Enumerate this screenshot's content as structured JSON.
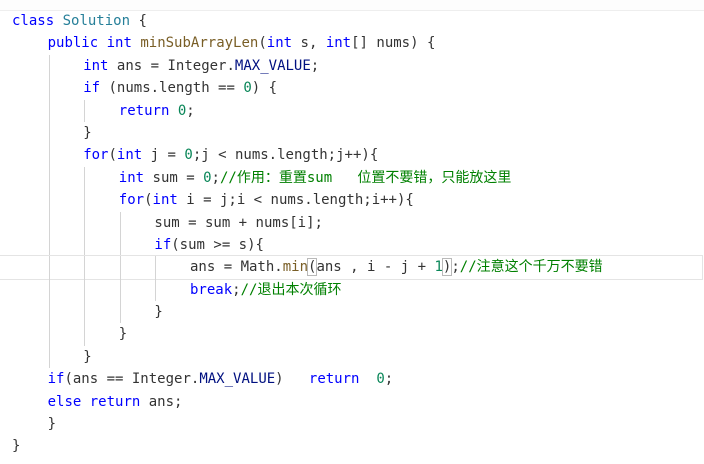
{
  "editor": {
    "lines": [
      {
        "indent": 0,
        "tokens": [
          [
            "kw",
            "class"
          ],
          [
            "plain",
            " "
          ],
          [
            "cls",
            "Solution"
          ],
          [
            "plain",
            " {"
          ]
        ]
      },
      {
        "indent": 1,
        "tokens": [
          [
            "kw",
            "public"
          ],
          [
            "plain",
            " "
          ],
          [
            "type",
            "int"
          ],
          [
            "plain",
            " "
          ],
          [
            "fn",
            "minSubArrayLen"
          ],
          [
            "plain",
            "("
          ],
          [
            "type",
            "int"
          ],
          [
            "plain",
            " s, "
          ],
          [
            "type",
            "int"
          ],
          [
            "plain",
            "[] nums) {"
          ]
        ]
      },
      {
        "indent": 2,
        "tokens": [
          [
            "type",
            "int"
          ],
          [
            "plain",
            " ans = Integer."
          ],
          [
            "field",
            "MAX_VALUE"
          ],
          [
            "plain",
            ";"
          ]
        ]
      },
      {
        "indent": 2,
        "tokens": [
          [
            "kw",
            "if"
          ],
          [
            "plain",
            " (nums.length == "
          ],
          [
            "num",
            "0"
          ],
          [
            "plain",
            ") {"
          ]
        ]
      },
      {
        "indent": 3,
        "tokens": [
          [
            "kw",
            "return"
          ],
          [
            "plain",
            " "
          ],
          [
            "num",
            "0"
          ],
          [
            "plain",
            ";"
          ]
        ]
      },
      {
        "indent": 2,
        "tokens": [
          [
            "plain",
            "}"
          ]
        ]
      },
      {
        "indent": 2,
        "tokens": [
          [
            "kw",
            "for"
          ],
          [
            "plain",
            "("
          ],
          [
            "type",
            "int"
          ],
          [
            "plain",
            " j = "
          ],
          [
            "num",
            "0"
          ],
          [
            "plain",
            ";j < nums.length;j++){"
          ]
        ]
      },
      {
        "indent": 3,
        "tokens": [
          [
            "type",
            "int"
          ],
          [
            "plain",
            " sum = "
          ],
          [
            "num",
            "0"
          ],
          [
            "plain",
            ";"
          ],
          [
            "comment",
            "//作用：重置sum   位置不要错，只能放这里"
          ]
        ]
      },
      {
        "indent": 3,
        "tokens": [
          [
            "kw",
            "for"
          ],
          [
            "plain",
            "("
          ],
          [
            "type",
            "int"
          ],
          [
            "plain",
            " i = j;i < nums.length;i++){"
          ]
        ]
      },
      {
        "indent": 4,
        "tokens": [
          [
            "plain",
            "sum = sum + nums[i];"
          ]
        ]
      },
      {
        "indent": 4,
        "tokens": [
          [
            "kw",
            "if"
          ],
          [
            "plain",
            "(sum >= s){"
          ]
        ]
      },
      {
        "indent": 5,
        "cursor": true,
        "tokens": [
          [
            "plain",
            "ans = Math."
          ],
          [
            "fn",
            "min"
          ],
          [
            "match",
            "("
          ],
          [
            "plain",
            "ans , i - j + "
          ],
          [
            "num",
            "1"
          ],
          [
            "match",
            ")"
          ],
          [
            "plain",
            ";"
          ],
          [
            "comment",
            "//注意这个千万不要错"
          ]
        ]
      },
      {
        "indent": 5,
        "tokens": [
          [
            "kw",
            "break"
          ],
          [
            "plain",
            ";"
          ],
          [
            "comment",
            "//退出本次循环"
          ]
        ]
      },
      {
        "indent": 4,
        "tokens": [
          [
            "plain",
            "}"
          ]
        ]
      },
      {
        "indent": 3,
        "tokens": [
          [
            "plain",
            "}"
          ]
        ]
      },
      {
        "indent": 2,
        "tokens": [
          [
            "plain",
            "}"
          ]
        ]
      },
      {
        "indent": 1,
        "tokens": [
          [
            "kw",
            "if"
          ],
          [
            "plain",
            "(ans == Integer."
          ],
          [
            "field",
            "MAX_VALUE"
          ],
          [
            "plain",
            ")   "
          ],
          [
            "kw",
            "return"
          ],
          [
            "plain",
            "  "
          ],
          [
            "num",
            "0"
          ],
          [
            "plain",
            ";"
          ]
        ]
      },
      {
        "indent": 1,
        "tokens": [
          [
            "kw",
            "else"
          ],
          [
            "plain",
            " "
          ],
          [
            "kw",
            "return"
          ],
          [
            "plain",
            " ans;"
          ]
        ]
      },
      {
        "indent": 1,
        "tokens": [
          [
            "plain",
            "}"
          ]
        ]
      },
      {
        "indent": 0,
        "tokens": [
          [
            "plain",
            "}"
          ]
        ]
      }
    ]
  },
  "colors": {
    "keyword": "#0000ff",
    "class": "#267f99",
    "function": "#795e26",
    "number": "#098658",
    "comment": "#008000",
    "field": "#001080",
    "text": "#333333"
  }
}
